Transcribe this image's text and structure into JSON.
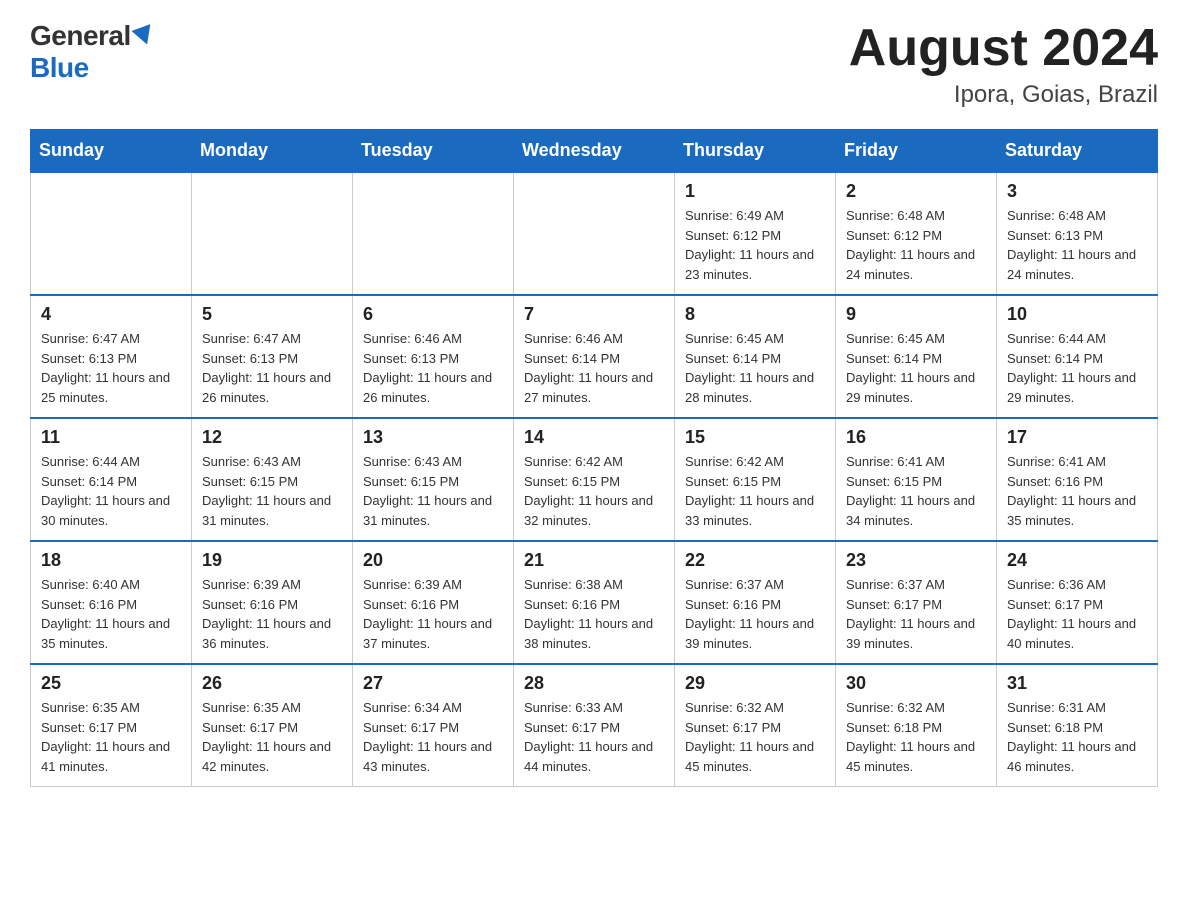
{
  "header": {
    "logo_general": "General",
    "logo_blue": "Blue",
    "month_title": "August 2024",
    "location": "Ipora, Goias, Brazil"
  },
  "weekdays": [
    "Sunday",
    "Monday",
    "Tuesday",
    "Wednesday",
    "Thursday",
    "Friday",
    "Saturday"
  ],
  "weeks": [
    [
      {
        "day": "",
        "info": ""
      },
      {
        "day": "",
        "info": ""
      },
      {
        "day": "",
        "info": ""
      },
      {
        "day": "",
        "info": ""
      },
      {
        "day": "1",
        "info": "Sunrise: 6:49 AM\nSunset: 6:12 PM\nDaylight: 11 hours and 23 minutes."
      },
      {
        "day": "2",
        "info": "Sunrise: 6:48 AM\nSunset: 6:12 PM\nDaylight: 11 hours and 24 minutes."
      },
      {
        "day": "3",
        "info": "Sunrise: 6:48 AM\nSunset: 6:13 PM\nDaylight: 11 hours and 24 minutes."
      }
    ],
    [
      {
        "day": "4",
        "info": "Sunrise: 6:47 AM\nSunset: 6:13 PM\nDaylight: 11 hours and 25 minutes."
      },
      {
        "day": "5",
        "info": "Sunrise: 6:47 AM\nSunset: 6:13 PM\nDaylight: 11 hours and 26 minutes."
      },
      {
        "day": "6",
        "info": "Sunrise: 6:46 AM\nSunset: 6:13 PM\nDaylight: 11 hours and 26 minutes."
      },
      {
        "day": "7",
        "info": "Sunrise: 6:46 AM\nSunset: 6:14 PM\nDaylight: 11 hours and 27 minutes."
      },
      {
        "day": "8",
        "info": "Sunrise: 6:45 AM\nSunset: 6:14 PM\nDaylight: 11 hours and 28 minutes."
      },
      {
        "day": "9",
        "info": "Sunrise: 6:45 AM\nSunset: 6:14 PM\nDaylight: 11 hours and 29 minutes."
      },
      {
        "day": "10",
        "info": "Sunrise: 6:44 AM\nSunset: 6:14 PM\nDaylight: 11 hours and 29 minutes."
      }
    ],
    [
      {
        "day": "11",
        "info": "Sunrise: 6:44 AM\nSunset: 6:14 PM\nDaylight: 11 hours and 30 minutes."
      },
      {
        "day": "12",
        "info": "Sunrise: 6:43 AM\nSunset: 6:15 PM\nDaylight: 11 hours and 31 minutes."
      },
      {
        "day": "13",
        "info": "Sunrise: 6:43 AM\nSunset: 6:15 PM\nDaylight: 11 hours and 31 minutes."
      },
      {
        "day": "14",
        "info": "Sunrise: 6:42 AM\nSunset: 6:15 PM\nDaylight: 11 hours and 32 minutes."
      },
      {
        "day": "15",
        "info": "Sunrise: 6:42 AM\nSunset: 6:15 PM\nDaylight: 11 hours and 33 minutes."
      },
      {
        "day": "16",
        "info": "Sunrise: 6:41 AM\nSunset: 6:15 PM\nDaylight: 11 hours and 34 minutes."
      },
      {
        "day": "17",
        "info": "Sunrise: 6:41 AM\nSunset: 6:16 PM\nDaylight: 11 hours and 35 minutes."
      }
    ],
    [
      {
        "day": "18",
        "info": "Sunrise: 6:40 AM\nSunset: 6:16 PM\nDaylight: 11 hours and 35 minutes."
      },
      {
        "day": "19",
        "info": "Sunrise: 6:39 AM\nSunset: 6:16 PM\nDaylight: 11 hours and 36 minutes."
      },
      {
        "day": "20",
        "info": "Sunrise: 6:39 AM\nSunset: 6:16 PM\nDaylight: 11 hours and 37 minutes."
      },
      {
        "day": "21",
        "info": "Sunrise: 6:38 AM\nSunset: 6:16 PM\nDaylight: 11 hours and 38 minutes."
      },
      {
        "day": "22",
        "info": "Sunrise: 6:37 AM\nSunset: 6:16 PM\nDaylight: 11 hours and 39 minutes."
      },
      {
        "day": "23",
        "info": "Sunrise: 6:37 AM\nSunset: 6:17 PM\nDaylight: 11 hours and 39 minutes."
      },
      {
        "day": "24",
        "info": "Sunrise: 6:36 AM\nSunset: 6:17 PM\nDaylight: 11 hours and 40 minutes."
      }
    ],
    [
      {
        "day": "25",
        "info": "Sunrise: 6:35 AM\nSunset: 6:17 PM\nDaylight: 11 hours and 41 minutes."
      },
      {
        "day": "26",
        "info": "Sunrise: 6:35 AM\nSunset: 6:17 PM\nDaylight: 11 hours and 42 minutes."
      },
      {
        "day": "27",
        "info": "Sunrise: 6:34 AM\nSunset: 6:17 PM\nDaylight: 11 hours and 43 minutes."
      },
      {
        "day": "28",
        "info": "Sunrise: 6:33 AM\nSunset: 6:17 PM\nDaylight: 11 hours and 44 minutes."
      },
      {
        "day": "29",
        "info": "Sunrise: 6:32 AM\nSunset: 6:17 PM\nDaylight: 11 hours and 45 minutes."
      },
      {
        "day": "30",
        "info": "Sunrise: 6:32 AM\nSunset: 6:18 PM\nDaylight: 11 hours and 45 minutes."
      },
      {
        "day": "31",
        "info": "Sunrise: 6:31 AM\nSunset: 6:18 PM\nDaylight: 11 hours and 46 minutes."
      }
    ]
  ]
}
